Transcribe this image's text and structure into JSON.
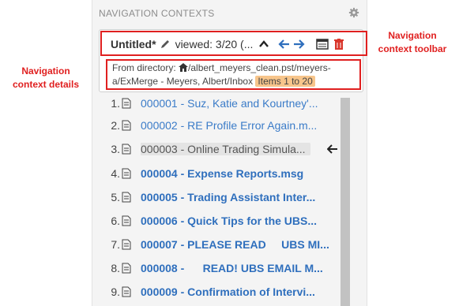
{
  "panel": {
    "title": "NAVIGATION CONTEXTS",
    "icons": {
      "settings": "gear-icon"
    }
  },
  "context": {
    "title": "Untitled*",
    "viewed": "viewed: 3/20 (...",
    "toolbar_icons": [
      "pencil-icon",
      "chevron-up-icon",
      "arrow-left-icon",
      "arrow-right-icon",
      "list-panel-icon",
      "trash-icon"
    ],
    "details_prefix": "From directory: ",
    "details_path_line1": "/albert_meyers_clean.pst/meyers-",
    "details_path_line2": "a/ExMerge - Meyers, Albert/Inbox ",
    "items_badge": "Items 1 to 20"
  },
  "items": [
    {
      "num": "1.",
      "name": "000001 - Suz, Katie and Kourtney'..."
    },
    {
      "num": "2.",
      "name": "000002 - RE  Profile Error Again.m..."
    },
    {
      "num": "3.",
      "name": "000003 - Online Trading Simula..."
    },
    {
      "num": "4.",
      "name": "000004 - Expense Reports.msg"
    },
    {
      "num": "5.",
      "name": "000005 - Trading Assistant Inter..."
    },
    {
      "num": "6.",
      "name": "000006 - Quick Tips for the UBS..."
    },
    {
      "num": "7.",
      "name": "000007 - PLEASE READ     UBS MI..."
    },
    {
      "num": "8.",
      "name": "000008 -      READ! UBS EMAIL M..."
    },
    {
      "num": "9.",
      "name": "000009 - Confirmation of Intervi..."
    }
  ],
  "annotations": {
    "toolbar_line1": "Navigation",
    "toolbar_line2": "context toolbar",
    "details_line1": "Navigation",
    "details_line2": "context details"
  },
  "colors": {
    "annotation_red": "#e02020",
    "link_blue": "#3a7bc8",
    "badge_orange": "#f7c58b",
    "trash_red": "#d9362b"
  }
}
